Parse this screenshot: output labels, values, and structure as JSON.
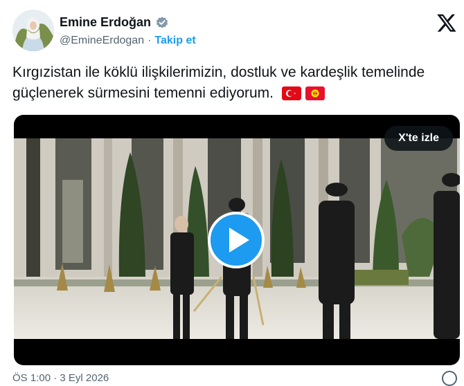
{
  "author": {
    "name": "Emine Erdoğan",
    "handle": "@EmineErdogan",
    "separator": "·",
    "follow_label": "Takip et"
  },
  "tweet": {
    "text": "Kırgızistan ile köklü ilişkilerimizin, dostluk ve kardeşlik temelinde güçlenerek sürmesini temenni ediyorum."
  },
  "video": {
    "watch_label": "X'te izle"
  },
  "footer": {
    "timestamp": "ÖS 1:00 · 3 Eyl 2026"
  },
  "colors": {
    "accent": "#1d9bf0",
    "verified": "#829aab",
    "text_secondary": "#536471"
  },
  "icons": [
    "verified-badge-icon",
    "x-logo-icon",
    "turkey-flag-icon",
    "kyrgyzstan-flag-icon",
    "play-icon",
    "info-icon"
  ]
}
